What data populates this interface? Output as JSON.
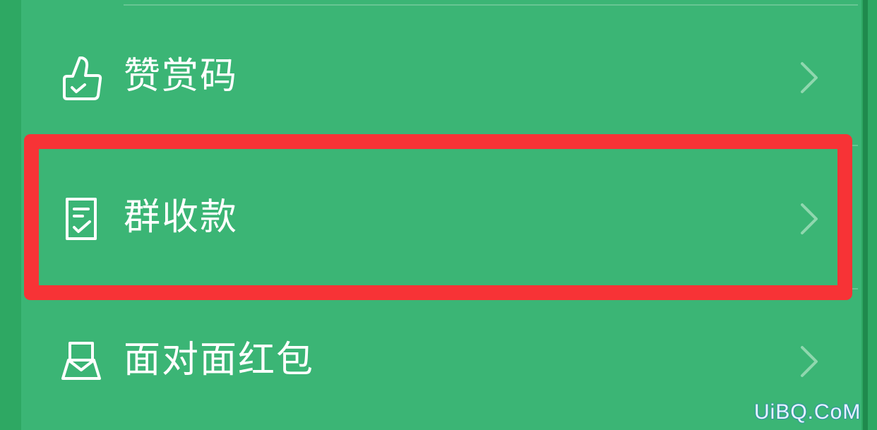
{
  "menu": {
    "items": [
      {
        "label": "赞赏码",
        "icon": "thumbs-up-check-icon",
        "highlighted": false
      },
      {
        "label": "群收款",
        "icon": "receipt-check-icon",
        "highlighted": true
      },
      {
        "label": "面对面红包",
        "icon": "red-packet-icon",
        "highlighted": false
      }
    ],
    "chevron_icon": "chevron-right-icon"
  },
  "watermark": "UiBQ.CoM",
  "colors": {
    "background": "#3bb575",
    "outer": "#2ea863",
    "highlight_border": "#f73336",
    "text": "#ffffff",
    "chevron": "#8fd7ae"
  }
}
